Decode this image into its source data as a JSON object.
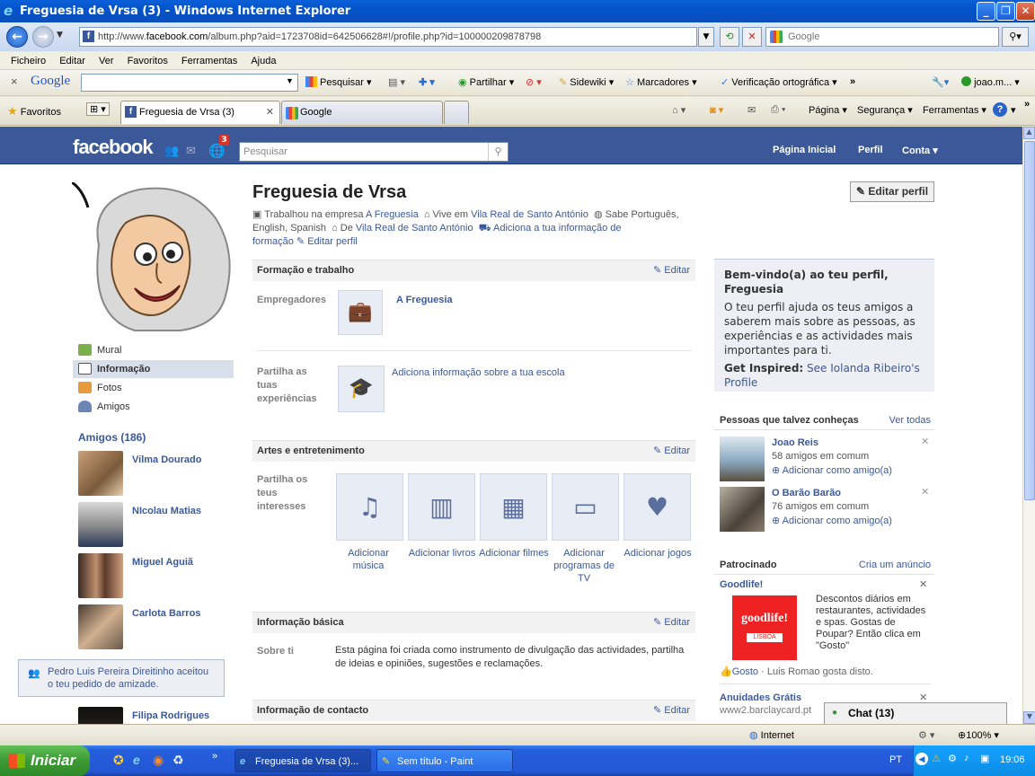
{
  "window": {
    "title": "Freguesia de Vrsa (3) - Windows Internet Explorer"
  },
  "browser": {
    "address": "http://www.facebook.com/album.php?aid=1723708id=642506628#!/profile.php?id=100000209878798",
    "address_prefix": "http://www.",
    "address_domain": "facebook.com",
    "address_rest": "/album.php?aid=1723708id=642506628#!/profile.php?id=100000209878798",
    "search_placeholder": "Google",
    "menu": [
      "Ficheiro",
      "Editar",
      "Ver",
      "Favoritos",
      "Ferramentas",
      "Ajuda"
    ],
    "gtoolbar": {
      "google": "Google",
      "pesquisar": "Pesquisar",
      "partilhar": "Partilhar",
      "sidewiki": "Sidewiki",
      "marcadores": "Marcadores",
      "verificacao": "Verificação ortográfica",
      "more": "»",
      "user": "joao.m..."
    },
    "favorites": "Favoritos",
    "tabs": [
      {
        "label": "Freguesia de Vrsa (3)"
      },
      {
        "label": "Google"
      }
    ],
    "cmd": {
      "pagina": "Página",
      "seguranca": "Segurança",
      "ferramentas": "Ferramentas"
    }
  },
  "fb": {
    "logo": "facebook",
    "notif_count": "3",
    "search_placeholder": "Pesquisar",
    "nav": {
      "home": "Página Inicial",
      "profile": "Perfil",
      "account": "Conta"
    },
    "left_nav": [
      {
        "label": "Mural"
      },
      {
        "label": "Informação"
      },
      {
        "label": "Fotos"
      },
      {
        "label": "Amigos"
      }
    ],
    "friends_title": "Amigos (186)",
    "friends": [
      {
        "name": "Vilma Dourado"
      },
      {
        "name": "NIcolau Matias"
      },
      {
        "name": "Miguel Aguiã"
      },
      {
        "name": "Carlota Barros"
      },
      {
        "name": "Filipa Rodrigues"
      }
    ],
    "notification": "Pedro Luis Pereira Direitinho aceitou o teu pedido de amizade.",
    "profile": {
      "name": "Freguesia de Vrsa",
      "edit_profile": "Editar perfil",
      "info_line1a": "Trabalhou na empresa",
      "info_line1b": "A Freguesia",
      "info_line1c": "Vive em",
      "info_line1d": "Vila Real de Santo António",
      "info_line1e": "Sabe Português,",
      "info_line2a": "English, Spanish",
      "info_line2b": "De",
      "info_line2c": "Vila Real de Santo António",
      "info_line2d": "Adiciona a tua informação de",
      "info_line3a": "formação",
      "info_line3b": "Editar perfil"
    },
    "sections": {
      "edit": "Editar",
      "formacao": "Formação e trabalho",
      "empregadores": "Empregadores",
      "employer": "A Freguesia",
      "partilha_exp": "Partilha as tuas experiências",
      "add_school": "Adiciona informação sobre a tua escola",
      "artes": "Artes e entretenimento",
      "partilha_int": "Partilha os teus interesses",
      "interests": [
        {
          "label": "Adicionar música"
        },
        {
          "label": "Adicionar livros"
        },
        {
          "label": "Adicionar filmes"
        },
        {
          "label": "Adicionar programas de TV"
        },
        {
          "label": "Adicionar jogos"
        }
      ],
      "basica": "Informação básica",
      "sobre_label": "Sobre ti",
      "sobre_text": "Esta página foi criada como instrumento de divulgação das actividades, partilha de ideias e opiniões, sugestões e reclamações.",
      "contacto": "Informação de contacto"
    },
    "welcome": {
      "title": "Bem-vindo(a) ao teu perfil, Freguesia",
      "text": "O teu perfil ajuda os teus amigos a saberem mais sobre as pessoas, as experiências e as actividades mais importantes para ti.",
      "inspired_label": "Get Inspired:",
      "inspired_link": "See Iolanda Ribeiro's Profile"
    },
    "pymk": {
      "title": "Pessoas que talvez conheças",
      "see_all": "Ver todas",
      "people": [
        {
          "name": "Joao Reis",
          "mutual": "58 amigos em comum",
          "add": "Adicionar como amigo(a)"
        },
        {
          "name": "O Barão Barão",
          "mutual": "76 amigos em comum",
          "add": "Adicionar como amigo(a)"
        }
      ]
    },
    "sponsored": {
      "title": "Patrocinado",
      "create": "Cria um anúncio",
      "ad1_title": "Goodlife!",
      "ad1_text": "Descontos diários em restaurantes, actividades e spas. Gostas de Poupar? Então clica em \"Gosto\"",
      "ad1_logo": "goodlife!",
      "ad1_logo_sub": "LISBOA",
      "ad1_like": "Gosto",
      "ad1_like_info": "· Luis Romao gosta disto.",
      "ad2_title": "Anuidades Grátis",
      "ad2_url": "www2.barclaycard.pt"
    },
    "chat": "Chat (13)"
  },
  "status": {
    "zone": "Internet",
    "zoom": "100%"
  },
  "taskbar": {
    "start": "Iniciar",
    "items": [
      {
        "label": "Freguesia de Vrsa (3)..."
      },
      {
        "label": "Sem título - Paint"
      }
    ],
    "lang": "PT",
    "time": "19:06"
  },
  "colors": {
    "fb_blue": "#3b5998",
    "xp_blue": "#245edb",
    "start_green": "#3c9a34"
  }
}
